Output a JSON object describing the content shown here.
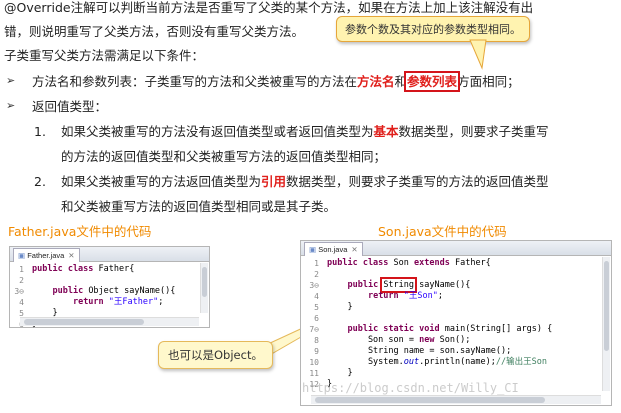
{
  "intro": {
    "line1": "@Override注解可以判断当前方法是否重写了父类的某个方法，如果在方法上加上该注解没有出",
    "line2": "错，则说明重写了父类方法，否则没有重写父类方法。",
    "line3": "子类重写父类方法需满足以下条件："
  },
  "callout_top": "参数个数及其对应的参数类型相同。",
  "bullets": [
    {
      "marker": "➢",
      "pre": "方法名和参数列表：子类重写的方法和父类被重写的方法在",
      "hl1": "方法名",
      "mid": "和",
      "hl2": "参数列表",
      "post": "方面相同；"
    },
    {
      "marker": "➢",
      "text": "返回值类型："
    }
  ],
  "sub_items": [
    {
      "num": "1.",
      "pre": "如果父类被重写的方法没有返回值类型或者返回值类型为",
      "hl": "基本",
      "post": "数据类型，则要求子类重写",
      "cont": "的方法的返回值类型和父类被重写方法的返回值类型相同；"
    },
    {
      "num": "2.",
      "pre": "如果父类被重写的方法返回值类型为",
      "hl": "引用",
      "post": "数据类型，则要求子类重写的方法的返回值类型",
      "cont": "和父类被重写方法的返回值类型相同或是其子类。"
    }
  ],
  "captions": {
    "father": "Father.java文件中的代码",
    "son": "Son.java文件中的代码"
  },
  "father_editor": {
    "tab": "Father.java",
    "close": "✕",
    "lines": [
      {
        "n": "1",
        "segs": [
          {
            "t": "public class ",
            "c": "kw"
          },
          {
            "t": "Father{",
            "c": ""
          }
        ]
      },
      {
        "n": "2",
        "segs": []
      },
      {
        "n": "3⊖",
        "segs": [
          {
            "t": "    ",
            "c": ""
          },
          {
            "t": "public ",
            "c": "kw"
          },
          {
            "t": "Object sayName(){",
            "c": ""
          }
        ]
      },
      {
        "n": "4",
        "segs": [
          {
            "t": "        ",
            "c": ""
          },
          {
            "t": "return ",
            "c": "kw"
          },
          {
            "t": "\"王Father\"",
            "c": "str"
          },
          {
            "t": ";",
            "c": ""
          }
        ]
      },
      {
        "n": "5",
        "segs": [
          {
            "t": "    }",
            "c": ""
          }
        ]
      },
      {
        "n": "6",
        "segs": [
          {
            "t": "}",
            "c": ""
          }
        ]
      }
    ]
  },
  "son_editor": {
    "tab": "Son.java",
    "close": "✕",
    "lines": [
      {
        "n": "1",
        "segs": [
          {
            "t": "public class ",
            "c": "kw"
          },
          {
            "t": "Son ",
            "c": ""
          },
          {
            "t": "extends ",
            "c": "kw"
          },
          {
            "t": "Father{",
            "c": ""
          }
        ]
      },
      {
        "n": "2",
        "segs": []
      },
      {
        "n": "3⊖",
        "segs": [
          {
            "t": "    ",
            "c": ""
          },
          {
            "t": "public ",
            "c": "kw"
          },
          {
            "t": "String",
            "c": "box"
          },
          {
            "t": " sayName(){",
            "c": ""
          }
        ]
      },
      {
        "n": "4",
        "segs": [
          {
            "t": "        ",
            "c": ""
          },
          {
            "t": "return ",
            "c": "kw"
          },
          {
            "t": "\"王Son\"",
            "c": "str"
          },
          {
            "t": ";",
            "c": ""
          }
        ]
      },
      {
        "n": "5",
        "segs": [
          {
            "t": "    }",
            "c": ""
          }
        ]
      },
      {
        "n": "6",
        "segs": []
      },
      {
        "n": "7⊖",
        "segs": [
          {
            "t": "    ",
            "c": ""
          },
          {
            "t": "public static void ",
            "c": "kw"
          },
          {
            "t": "main(String[] args) {",
            "c": ""
          }
        ]
      },
      {
        "n": "8",
        "segs": [
          {
            "t": "        Son son = ",
            "c": ""
          },
          {
            "t": "new ",
            "c": "kw"
          },
          {
            "t": "Son();",
            "c": ""
          }
        ]
      },
      {
        "n": "9",
        "segs": [
          {
            "t": "        String name = son.sayName();",
            "c": ""
          }
        ]
      },
      {
        "n": "10",
        "segs": [
          {
            "t": "        System.",
            "c": ""
          },
          {
            "t": "out",
            "c": "fld"
          },
          {
            "t": ".println(name);",
            "c": ""
          },
          {
            "t": "//输出王Son",
            "c": "cm"
          }
        ]
      },
      {
        "n": "11",
        "segs": [
          {
            "t": "    }",
            "c": ""
          }
        ]
      },
      {
        "n": "12",
        "segs": [
          {
            "t": "}",
            "c": ""
          }
        ]
      }
    ]
  },
  "callout_bottom": "也可以是Object。",
  "watermark": "https://blog.csdn.net/Willy_CI",
  "colors": {
    "highlight_red": "#e0201c",
    "caption_orange": "#f08a00",
    "callout_fill": "#fff8cc",
    "keyword": "#7f0055",
    "string": "#2a00ff",
    "comment": "#3f7f5f"
  }
}
